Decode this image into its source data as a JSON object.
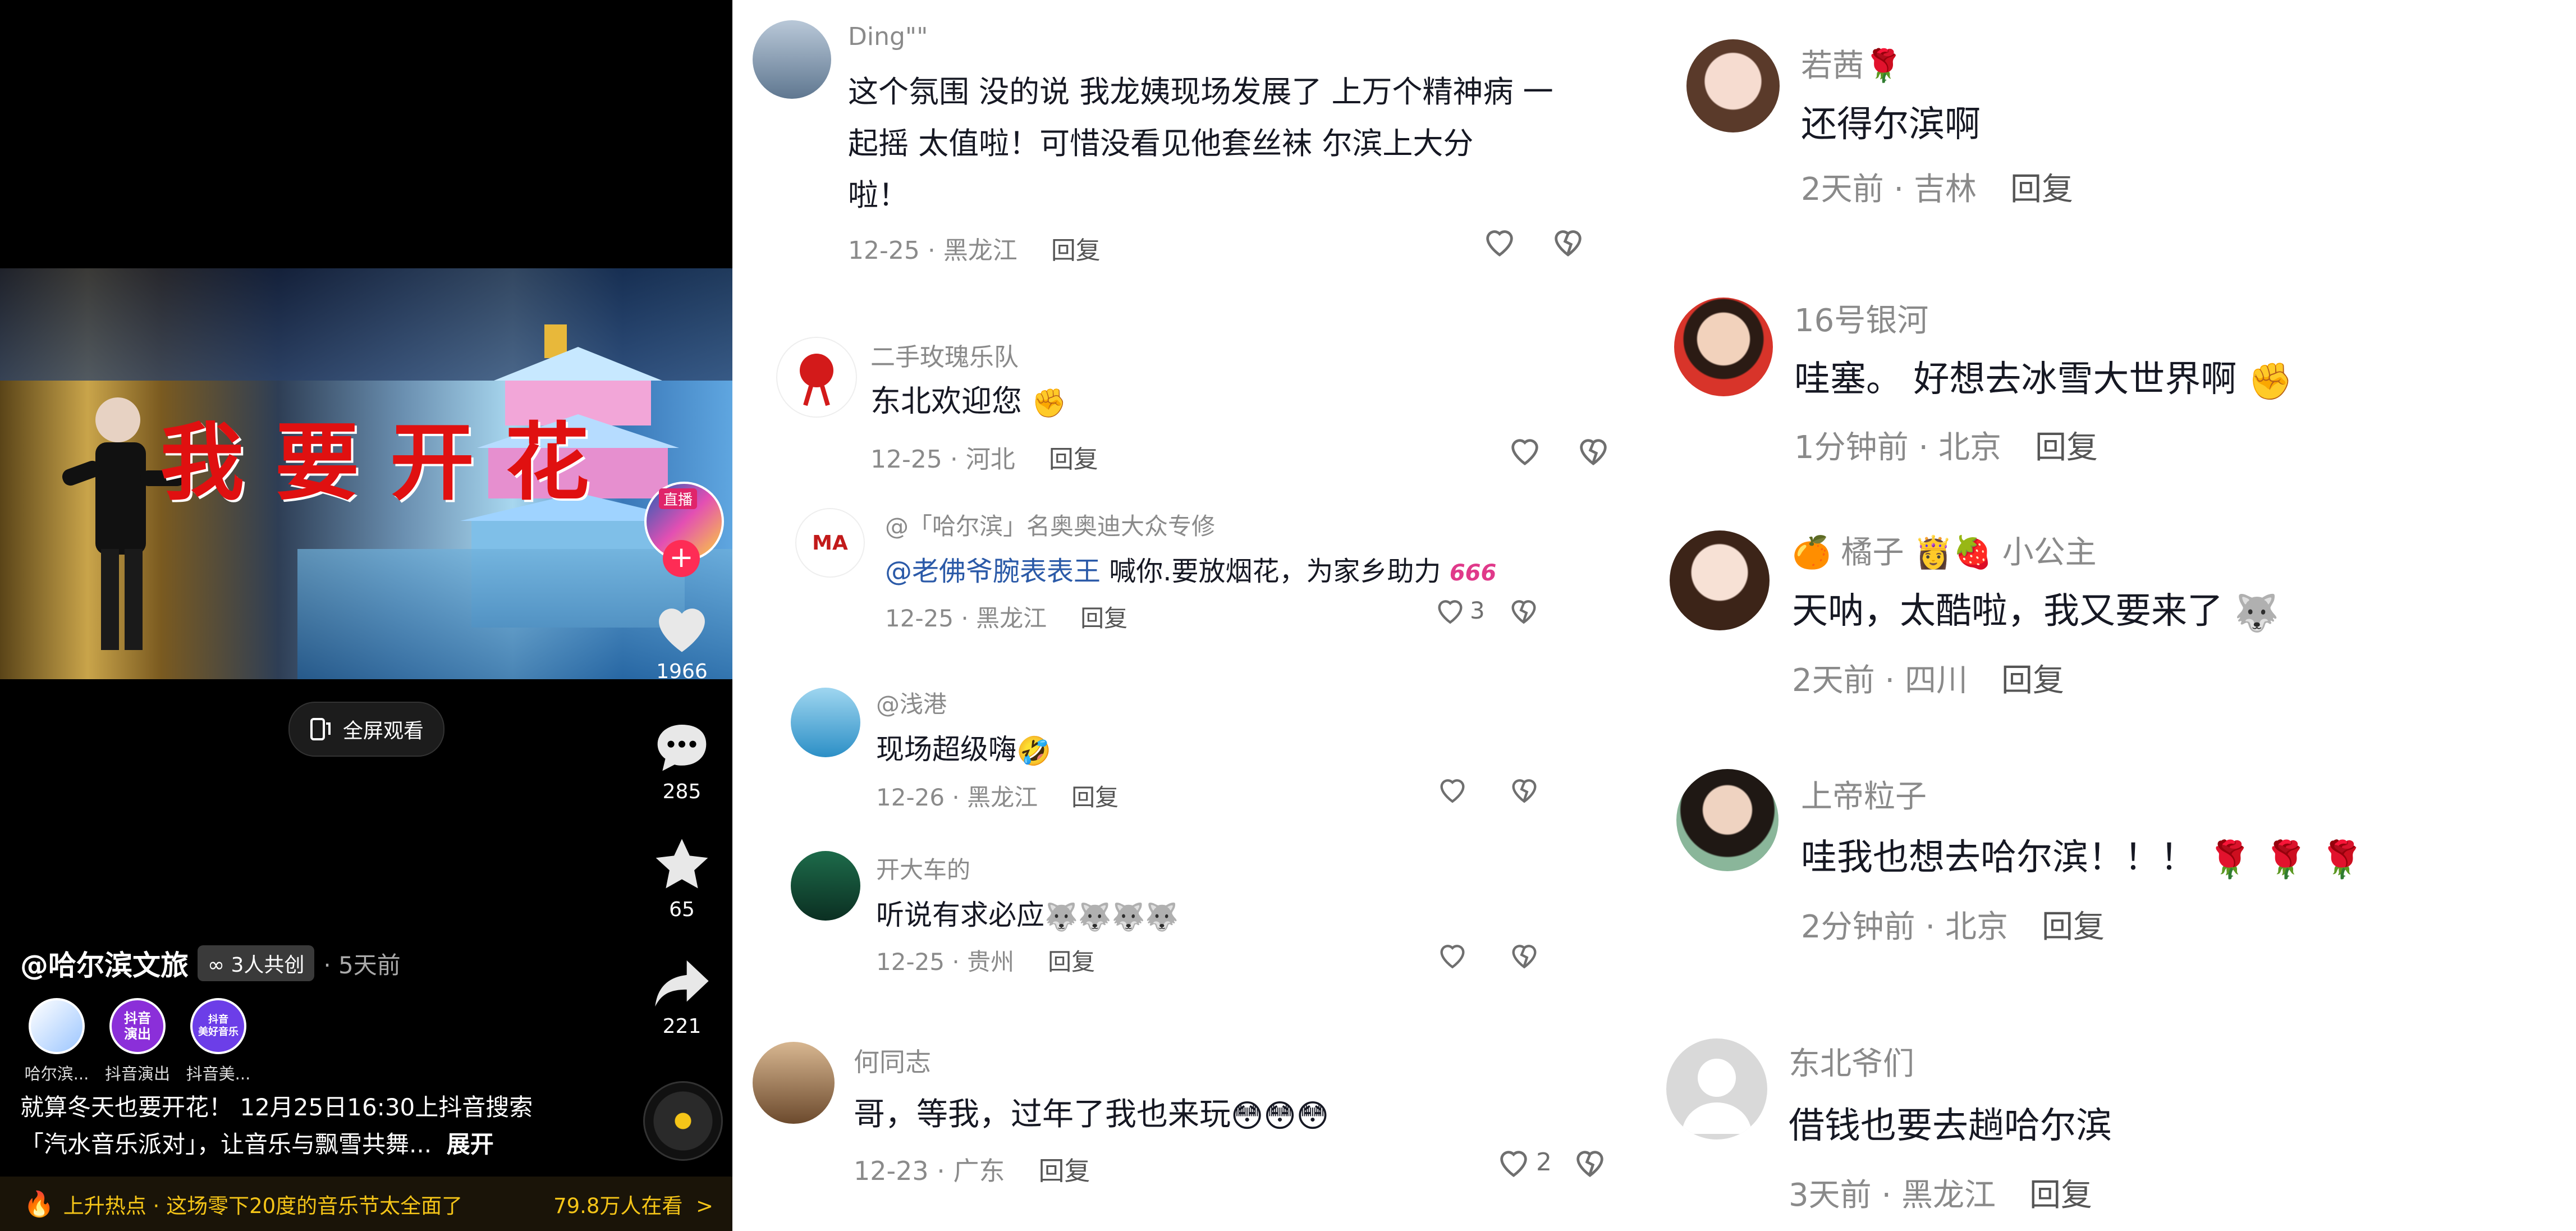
{
  "video": {
    "caption": "我要开花",
    "fullscreen_label": "全屏观看",
    "likes": "1966",
    "comments": "285",
    "favorites": "65",
    "shares": "221",
    "author": "@哈尔滨文旅",
    "co_create": "3人共创",
    "time": "· 5天前",
    "collaborators": [
      "哈尔滨...",
      "抖音演出",
      "抖音美..."
    ],
    "avatar_texts": [
      "抖音\n演出",
      "抖音\n美好音乐"
    ],
    "author_avatar_tag": "直播",
    "description_line1": "就算冬天也要开花！ 12月25日16:30上抖音搜索",
    "description_line2": "「汽水音乐派对」，让音乐与飘雪共舞...",
    "expand_label": "展开",
    "hot_text": "上升热点 · 这场零下20度的音乐节太全面了",
    "hot_viewers": "79.8万人在看",
    "hot_chevron": ">"
  },
  "middle_comments": [
    {
      "name": "Ding\"\"",
      "lines": [
        "这个氛围 没的说  我龙姨现场发展了 上万个精神病 一",
        "起摇   太值啦！可惜没看见他套丝袜   尔滨上大分",
        "啦！"
      ],
      "meta": "12-25 · 黑龙江",
      "reply": "回复"
    },
    {
      "name": "二手玫瑰乐队",
      "text": "东北欢迎您",
      "meta": "12-25 · 河北",
      "reply": "回复"
    },
    {
      "name": "@「哈尔滨」名奥奥迪大众专修",
      "mention": "@老佛爷腕表表王",
      "text": " 喊你.要放烟花，为家乡助力",
      "emoji_text": "666",
      "meta": "12-25 · 黑龙江",
      "reply": "回复",
      "likes": "3",
      "avatar_text": "MA"
    },
    {
      "name": "@浅港",
      "text": "现场超级嗨",
      "meta": "12-26 · 黑龙江",
      "reply": "回复"
    },
    {
      "name": "开大车的",
      "text": "听说有求必应",
      "meta": "12-25 · 贵州",
      "reply": "回复"
    },
    {
      "name": "何同志",
      "text": "哥，等我，过年了我也来玩",
      "meta": "12-23 · 广东",
      "reply": "回复",
      "likes": "2"
    }
  ],
  "right_comments": [
    {
      "name": "若茜",
      "text": "还得尔滨啊",
      "meta": "2天前 · 吉林",
      "reply": "回复"
    },
    {
      "name": "16号银河",
      "text": "哇塞。 好想去冰雪大世界啊",
      "meta": "1分钟前 · 北京",
      "reply": "回复"
    },
    {
      "name": "橘子",
      "name_suffix": "小公主",
      "text": "天呐，太酷啦，我又要来了",
      "meta": "2天前 · 四川",
      "reply": "回复"
    },
    {
      "name": "上帝粒子",
      "text": "哇我也想去哈尔滨！！！",
      "meta": "2分钟前 · 北京",
      "reply": "回复"
    },
    {
      "name": "东北爷们",
      "text": "借钱也要去趟哈尔滨",
      "meta": "3天前 · 黑龙江",
      "reply": "回复"
    }
  ]
}
